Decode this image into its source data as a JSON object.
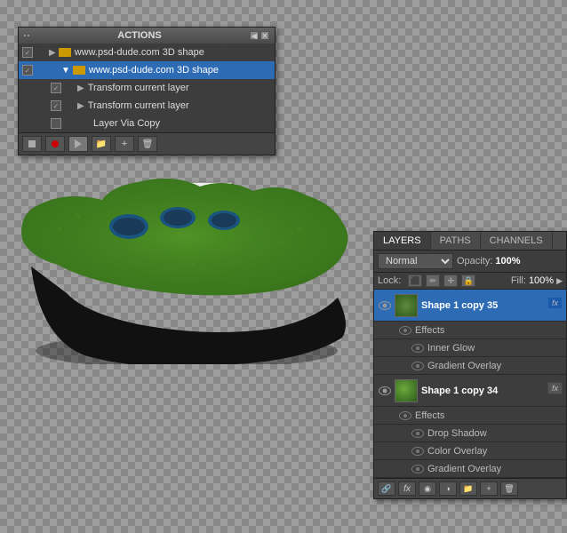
{
  "actions_panel": {
    "title": "ACTIONS",
    "items": [
      {
        "indent": 0,
        "label": "www.psd-dude.com 3D shape",
        "type": "group",
        "checked": true,
        "selected": false
      },
      {
        "indent": 1,
        "label": "www.psd-dude.com 3D shape",
        "type": "group",
        "checked": true,
        "selected": true
      },
      {
        "indent": 2,
        "label": "Transform current layer",
        "type": "action",
        "checked": true,
        "selected": false
      },
      {
        "indent": 2,
        "label": "Transform current layer",
        "type": "action",
        "checked": true,
        "selected": false
      },
      {
        "indent": 2,
        "label": "Layer Via Copy",
        "type": "action",
        "checked": false,
        "selected": false
      }
    ],
    "toolbar": {
      "stop_label": "■",
      "record_label": "●",
      "play_label": "▶",
      "new_label": "+"
    }
  },
  "play_selection_btn": {
    "label": "Play selection"
  },
  "layers_panel": {
    "tabs": [
      "LAYERS",
      "PATHS",
      "CHANNELS"
    ],
    "active_tab": "LAYERS",
    "blend_mode": "Normal",
    "opacity_label": "Opacity:",
    "opacity_value": "100%",
    "lock_label": "Lock:",
    "fill_label": "Fill:",
    "fill_value": "100%",
    "layers": [
      {
        "name": "Shape 1 copy 35",
        "visible": true,
        "selected": true,
        "effects": [
          {
            "name": "Effects",
            "visible": true
          },
          {
            "name": "Inner Glow",
            "visible": true
          },
          {
            "name": "Gradient Overlay",
            "visible": true
          }
        ]
      },
      {
        "name": "Shape 1 copy 34",
        "visible": true,
        "selected": false,
        "effects": [
          {
            "name": "Effects",
            "visible": true
          },
          {
            "name": "Drop Shadow",
            "visible": true
          },
          {
            "name": "Color Overlay",
            "visible": true
          },
          {
            "name": "Gradient Overlay",
            "visible": true
          }
        ]
      }
    ]
  }
}
